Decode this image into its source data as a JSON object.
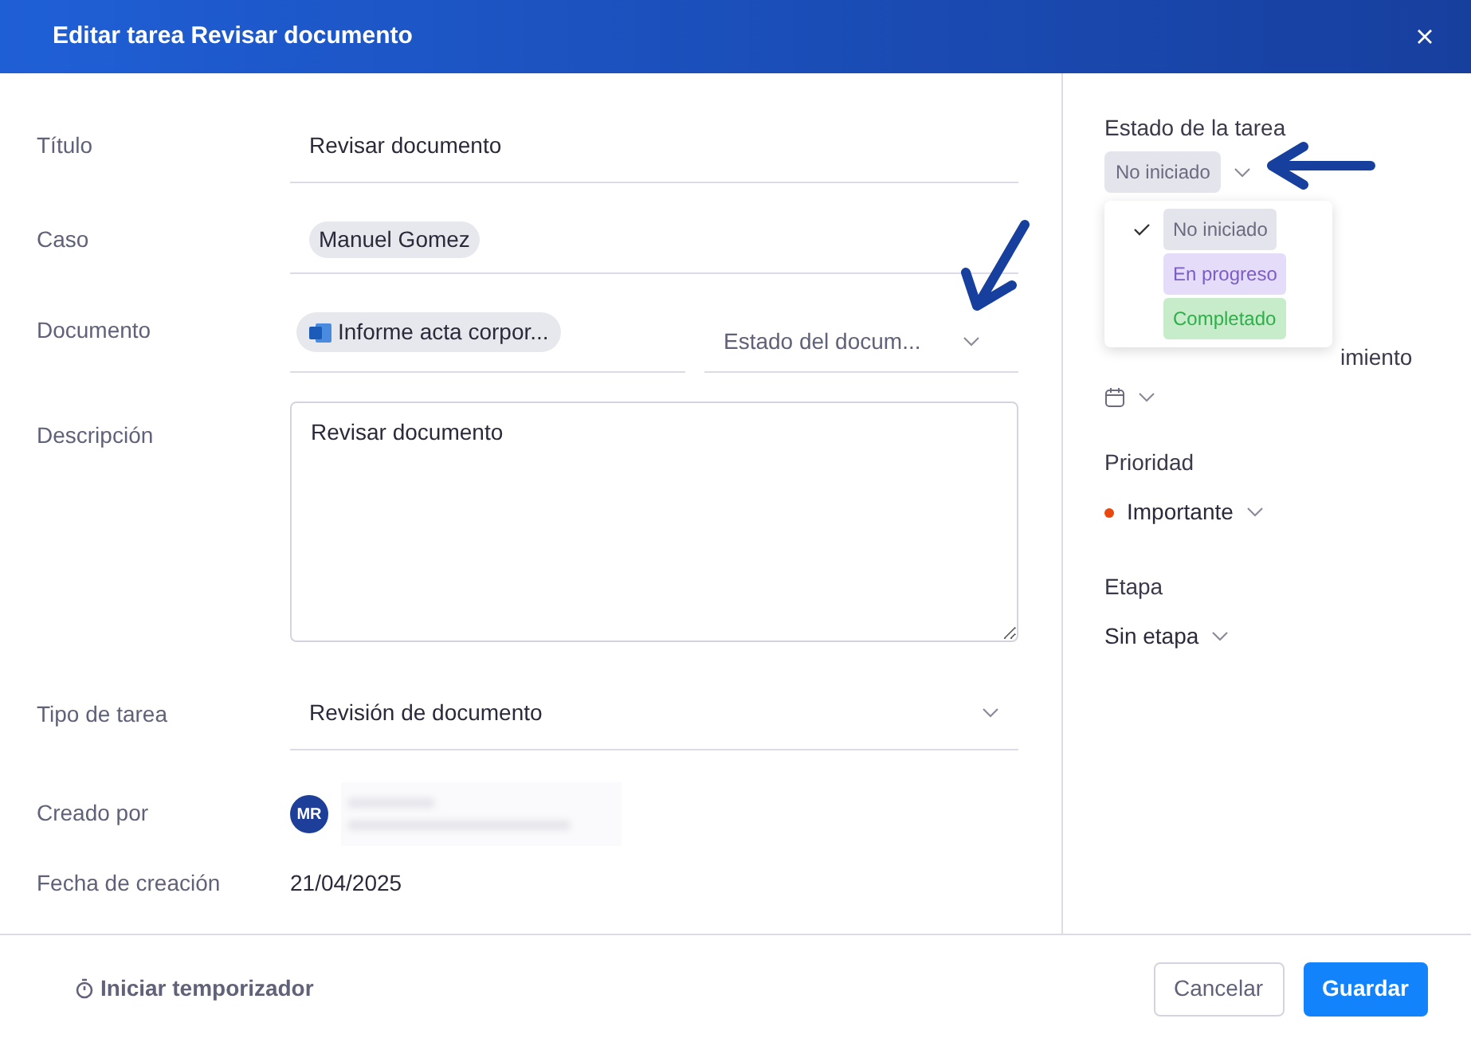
{
  "dialog": {
    "title": "Editar tarea Revisar documento"
  },
  "fields": [
    {
      "kind": "text",
      "label": "Título",
      "value": "Revisar documento"
    },
    {
      "kind": "chip",
      "label": "Caso",
      "value": "Manuel Gomez"
    },
    {
      "kind": "document",
      "label": "Documento",
      "value": "Informe acta corpor...",
      "placeholder": "Estado del docum..."
    },
    {
      "kind": "textarea",
      "label": "Descripción",
      "value": "Revisar documento"
    },
    {
      "kind": "select",
      "label": "Tipo de tarea",
      "value": "Revisión de documento"
    },
    {
      "kind": "user",
      "label": "Creado por",
      "initials": "MR"
    },
    {
      "kind": "plain",
      "label": "Fecha de creación",
      "value": "21/04/2025"
    }
  ],
  "side": {
    "task_status": {
      "label": "Estado de la tarea",
      "value": "No iniciado",
      "expanded": true,
      "options": [
        {
          "label": "No iniciado",
          "selected": true,
          "color": "#e4e4ec"
        },
        {
          "label": "En progreso",
          "selected": false,
          "color": "#e4dcf8"
        },
        {
          "label": "Completado",
          "selected": false,
          "color": "#c6ecca"
        }
      ]
    },
    "due_label": "imiento",
    "priority": {
      "label": "Prioridad",
      "value": "Importante",
      "color": "#e8470e"
    },
    "stage": {
      "label": "Etapa",
      "value": "Sin etapa"
    }
  },
  "footer": {
    "timer": "Iniciar temporizador",
    "buttons": [
      {
        "kind": "secondary",
        "label": "Cancelar"
      },
      {
        "kind": "primary",
        "label": "Guardar"
      }
    ]
  }
}
